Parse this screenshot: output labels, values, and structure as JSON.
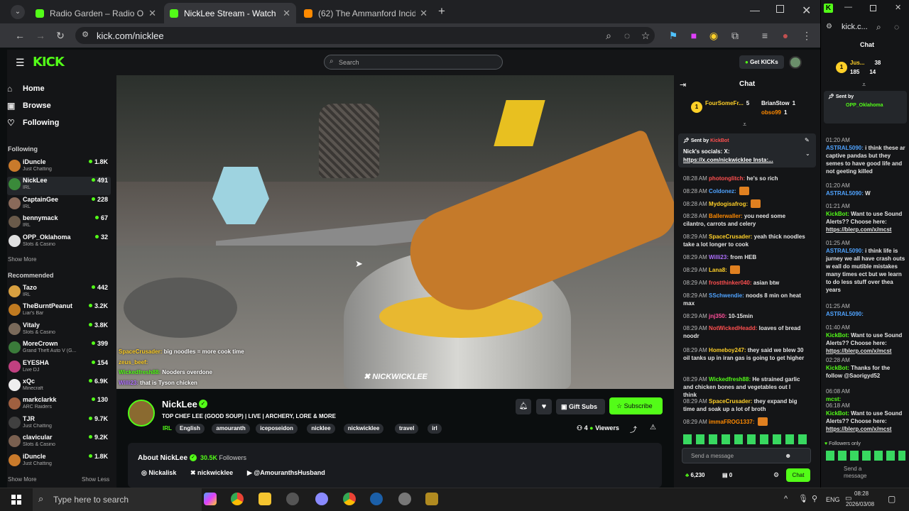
{
  "browser": {
    "tabs": [
      {
        "title": "Radio Garden – Radio Orania 9",
        "color": "#53fc18",
        "active": false
      },
      {
        "title": "NickLee Stream - Watch Live",
        "color": "#53fc18",
        "active": true
      },
      {
        "title": "(62) The Ammanford Incide",
        "color": "#ff8a00",
        "active": false
      }
    ],
    "url": "kick.com/nicklee"
  },
  "kick": {
    "logo": "KICK",
    "search_placeholder": "Search",
    "get_kicks": "Get KICKs",
    "nav": [
      {
        "label": "Home",
        "icon": "home-icon"
      },
      {
        "label": "Browse",
        "icon": "browse-icon"
      },
      {
        "label": "Following",
        "icon": "heart-icon"
      }
    ],
    "following_header": "Following",
    "following": [
      {
        "name": "iDuncle",
        "category": "Just Chatting",
        "viewers": "1.8K",
        "color": "#c97a2b"
      },
      {
        "name": "NickLee",
        "category": "IRL",
        "viewers": "491",
        "color": "#3a8a3a"
      },
      {
        "name": "CaptainGee",
        "category": "IRL",
        "viewers": "228",
        "color": "#8a6a5a"
      },
      {
        "name": "bennymack",
        "category": "IRL",
        "viewers": "67",
        "color": "#6a5a4a"
      },
      {
        "name": "OPP_Oklahoma",
        "category": "Slots & Casino",
        "viewers": "32",
        "color": "#e0e0e0"
      }
    ],
    "show_more": "Show More",
    "recommended_header": "Recommended",
    "recommended": [
      {
        "name": "Tazo",
        "category": "IRL",
        "viewers": "442",
        "color": "#d8a040"
      },
      {
        "name": "TheBurntPeanut",
        "category": "Liar's Bar",
        "viewers": "3.2K",
        "color": "#c07a20"
      },
      {
        "name": "Vitaly",
        "category": "Slots & Casino",
        "viewers": "3.8K",
        "color": "#7a6a5a"
      },
      {
        "name": "MoreCrown",
        "category": "Grand Theft Auto V (G...",
        "viewers": "399",
        "color": "#3a7a3a"
      },
      {
        "name": "EYESHA",
        "category": "Live DJ",
        "viewers": "154",
        "color": "#c04080"
      },
      {
        "name": "xQc",
        "category": "Minecraft",
        "viewers": "6.9K",
        "color": "#eeeeee"
      },
      {
        "name": "markclarkk",
        "category": "ARC Raiders",
        "viewers": "130",
        "color": "#a06040"
      },
      {
        "name": "TJR",
        "category": "Just Chatting",
        "viewers": "9.7K",
        "color": "#404040"
      },
      {
        "name": "clavicular",
        "category": "Slots & Casino",
        "viewers": "9.2K",
        "color": "#7a6050"
      },
      {
        "name": "iDuncle",
        "category": "Just Chatting",
        "viewers": "1.8K",
        "color": "#c97a2b"
      }
    ],
    "show_more_bottom": "Show More",
    "show_less": "Show Less"
  },
  "video": {
    "overlay_chat": [
      {
        "user": "SpaceCrusader:",
        "text": "big noodles = more cook time",
        "color": "#ffd028"
      },
      {
        "user": "zeus_beef:",
        "text": "",
        "color": "#ffd028"
      },
      {
        "user": "Wickedfresh88:",
        "text": "Nooders overdone",
        "color": "#53fc18"
      },
      {
        "user": "Willi23:",
        "text": "that is Tyson chicken",
        "color": "#b070ff"
      }
    ],
    "watermark": "NICKWICKLEE"
  },
  "streamer": {
    "name": "NickLee",
    "title": "TOP CHEF LEE (GOOD SOUP) | LIVE | ARCHERY, LORE & MORE",
    "category": "IRL",
    "tags": [
      "English",
      "amouranth",
      "iceposeidon",
      "nicklee",
      "nickwicklee",
      "travel",
      "irl"
    ],
    "viewers": "4",
    "viewers_label": "Viewers",
    "gift_subs": "Gift Subs",
    "subscribe": "Subscribe",
    "about_label": "About NickLee",
    "followers": "30.5K",
    "followers_label": "Followers",
    "socials": [
      {
        "label": "Nickalisk",
        "icon": "instagram-icon"
      },
      {
        "label": "nickwicklee",
        "icon": "x-icon"
      },
      {
        "label": "@AmouranthsHusband",
        "icon": "youtube-icon"
      }
    ]
  },
  "chat": {
    "title": "Chat",
    "top_gifters": [
      {
        "name": "FourSomeFr...",
        "count": "5"
      },
      {
        "name": "BrianStow",
        "count": "1"
      },
      {
        "name": "obso99",
        "count": "1"
      }
    ],
    "pinned": {
      "sent_by": "Sent by",
      "bot": "KickBot",
      "text1": "Nick's socials: X:",
      "text2": "https://x.com/nickwicklee Insta:..."
    },
    "messages": [
      {
        "time": "08:28 AM",
        "user": "photonglitch:",
        "text": "he's so rich",
        "color": "#ff4f4f"
      },
      {
        "time": "08:28 AM",
        "user": "Coldonez:",
        "text": "",
        "color": "#4fa3ff"
      },
      {
        "time": "08:28 AM",
        "user": "Mydogisafrog:",
        "text": "",
        "color": "#ffd028"
      },
      {
        "time": "08:28 AM",
        "user": "Ballerwaller:",
        "text": "you need some cilantro, carrots and celery",
        "color": "#ff8a00"
      },
      {
        "time": "08:29 AM",
        "user": "SpaceCrusader:",
        "text": "yeah thick noodles take a lot longer to cook",
        "color": "#ffd028"
      },
      {
        "time": "08:29 AM",
        "user": "Willi23:",
        "text": "from HEB",
        "color": "#b070ff"
      },
      {
        "time": "08:29 AM",
        "user": "Lana8:",
        "text": "",
        "color": "#ffd028"
      },
      {
        "time": "08:29 AM",
        "user": "frostthinker040:",
        "text": "asian btw",
        "color": "#ff4f4f"
      },
      {
        "time": "08:29 AM",
        "user": "SSchwendie:",
        "text": "noods 8 min on heat max",
        "color": "#4fa3ff"
      },
      {
        "time": "08:29 AM",
        "user": "jnj350:",
        "text": "10-15min",
        "color": "#ff4f9a"
      },
      {
        "time": "08:29 AM",
        "user": "NotWickedHeadd:",
        "text": "loaves of bread noodr",
        "color": "#ff4f4f"
      },
      {
        "time": "08:29 AM",
        "user": "Homeboy247:",
        "text": "they said we blew 30 oil tanks up in iran gas is going to get higher",
        "color": "#ffd028"
      },
      {
        "time": "08:29 AM",
        "user": "Wickedfresh88:",
        "text": "He strained garlic and chicken bones and vegetables out I think",
        "color": "#53fc18"
      },
      {
        "time": "08:29 AM",
        "user": "SpaceCrusader:",
        "text": "they expand big time and soak up a lot of broth",
        "color": "#ffd028"
      },
      {
        "time": "08:29 AM",
        "user": "immaFROG1337:",
        "text": "",
        "color": "#ff8a00"
      }
    ],
    "input_placeholder": "Send a message",
    "kicks_balance": "6,230",
    "coins": "0",
    "chat_button": "Chat"
  },
  "popout": {
    "url": "kick.c...",
    "title": "Chat",
    "gifters": [
      {
        "name": "Jus...",
        "count": "38"
      },
      {
        "name": "185",
        "count": "14"
      }
    ],
    "pinned_sent_by": "Sent by",
    "pinned_user": "OPP_Oklahoma",
    "messages": [
      {
        "time": "01:20 AM",
        "user": "ASTRAL5090:",
        "text": "i think these ar captive pandas but they semes to have good life and not geeting killed",
        "color": "#4fa3ff"
      },
      {
        "time": "01:20 AM",
        "user": "ASTRAL5090:",
        "text": "W",
        "color": "#4fa3ff"
      },
      {
        "time": "01:21 AM",
        "user": "KickBot:",
        "text": "Want to use Sound Alerts?? Choose here:",
        "color": "#53fc18",
        "link": "https://blerp.com/x/mcst"
      },
      {
        "time": "01:25 AM",
        "user": "ASTRAL5090:",
        "text": "i think life is jurney we all have crash outs w eall do mutible mistakes many times ect but we learn to do less stuff over thea years",
        "color": "#4fa3ff"
      },
      {
        "time": "01:25 AM",
        "user": "ASTRAL5090:",
        "text": "",
        "color": "#4fa3ff"
      },
      {
        "time": "01:40 AM",
        "user": "KickBot:",
        "text": "Want to use Sound Alerts?? Choose here:",
        "color": "#53fc18",
        "link": "https://blerp.com/x/mcst"
      },
      {
        "time": "02:28 AM",
        "user": "KickBot:",
        "text": "Thanks for the follow @Saorigyd52",
        "color": "#53fc18"
      },
      {
        "time": "06:08 AM",
        "user": "mcst:",
        "text": "",
        "color": "#53fc18"
      },
      {
        "time": "06:18 AM",
        "user": "KickBot:",
        "text": "Want to use Sound Alerts?? Choose here:",
        "color": "#53fc18",
        "link": "https://blerp.com/x/mcst"
      }
    ],
    "followers_only": "Followers only",
    "input_placeholder": "Send a message"
  },
  "taskbar": {
    "search_placeholder": "Type here to search",
    "lang": "ENG",
    "time": "08:28",
    "date": "2026/03/08"
  }
}
